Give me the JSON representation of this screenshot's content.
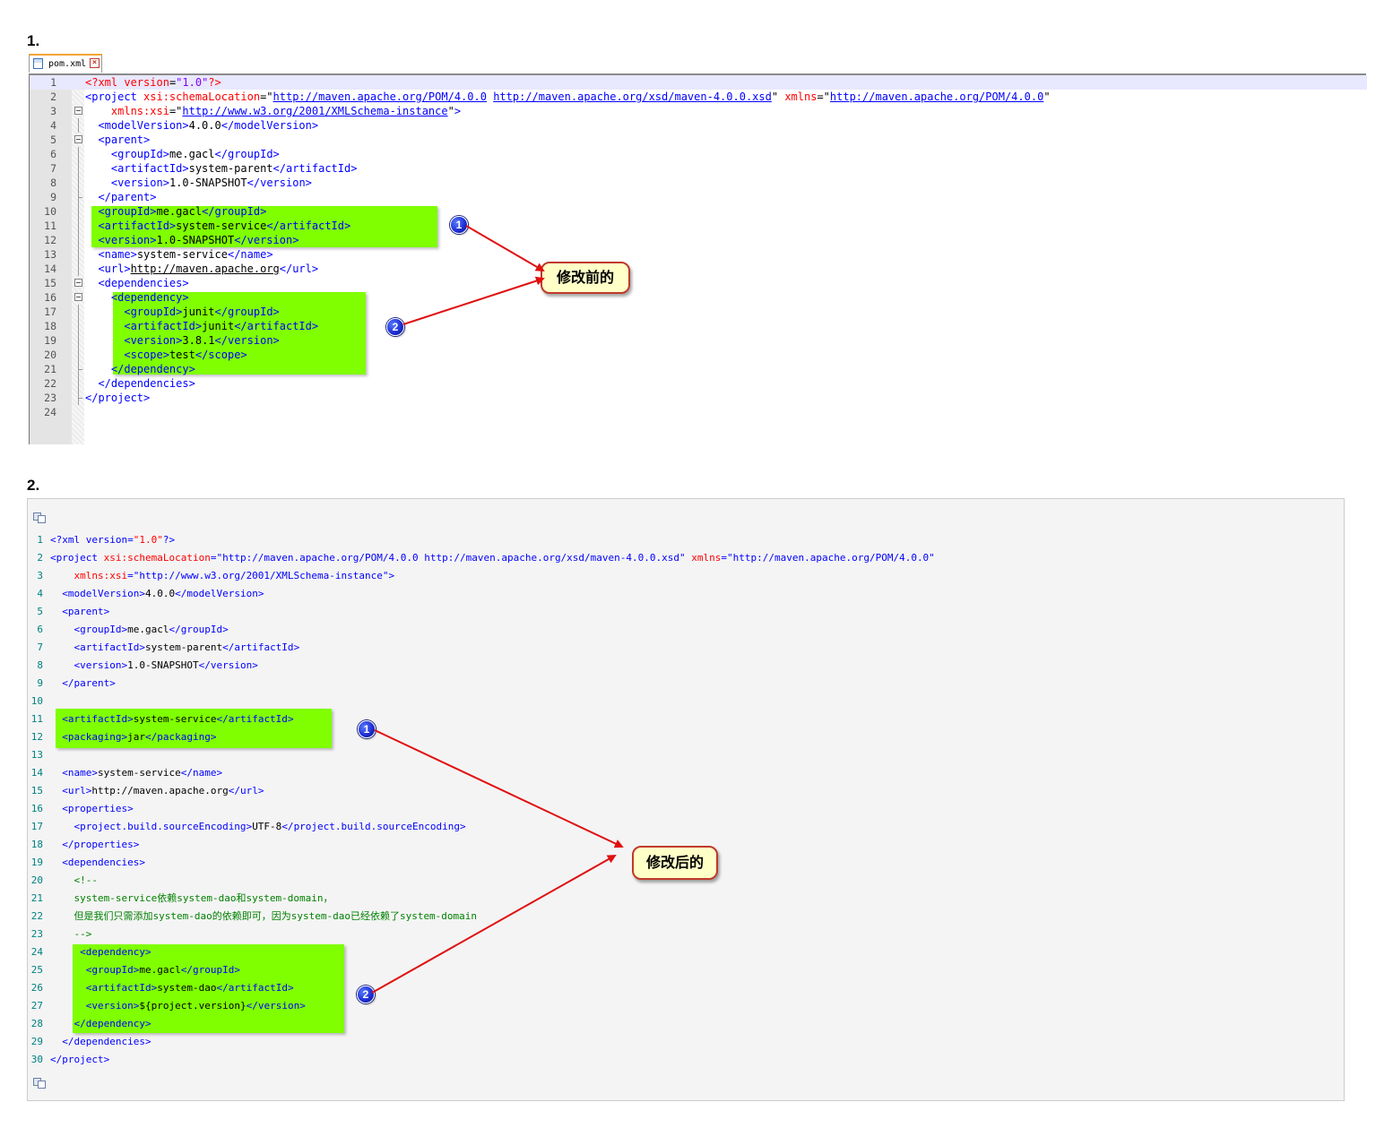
{
  "section1": {
    "heading": "1.",
    "tab_label": "pom.xml",
    "callout_label": "修改前的",
    "lines": [
      {
        "n": "1",
        "indent": "",
        "parts": [
          [
            "pi",
            "<?"
          ],
          [
            "pi",
            "xml "
          ],
          [
            "attr",
            "version"
          ],
          [
            "dq",
            "="
          ],
          [
            "val",
            "\"1.0\""
          ],
          [
            "pi",
            "?>"
          ]
        ]
      },
      {
        "n": "2",
        "indent": "",
        "parts": [
          [
            "tag",
            "<project "
          ],
          [
            "attr",
            "xsi:schemaLocation"
          ],
          [
            "dq",
            "=\""
          ],
          [
            "url",
            "http://maven.apache.org/POM/4.0.0"
          ],
          [
            "dq",
            " "
          ],
          [
            "url",
            "http://maven.apache.org/xsd/maven-4.0.0.xsd"
          ],
          [
            "dq",
            "\" "
          ],
          [
            "attr",
            "xmlns"
          ],
          [
            "dq",
            "=\""
          ],
          [
            "url",
            "http://maven.apache.org/POM/4.0.0"
          ],
          [
            "dq",
            "\""
          ]
        ]
      },
      {
        "n": "3",
        "indent": "    ",
        "parts": [
          [
            "attr",
            "xmlns:xsi"
          ],
          [
            "dq",
            "=\""
          ],
          [
            "url",
            "http://www.w3.org/2001/XMLSchema-instance"
          ],
          [
            "dq",
            "\""
          ],
          [
            "tag",
            ">"
          ]
        ]
      },
      {
        "n": "4",
        "indent": "  ",
        "parts": [
          [
            "tag",
            "<modelVersion>"
          ],
          [
            "text",
            "4.0.0"
          ],
          [
            "tag",
            "</modelVersion>"
          ]
        ]
      },
      {
        "n": "5",
        "indent": "  ",
        "parts": [
          [
            "tag",
            "<parent>"
          ]
        ]
      },
      {
        "n": "6",
        "indent": "    ",
        "parts": [
          [
            "tag",
            "<groupId>"
          ],
          [
            "text",
            "me.gacl"
          ],
          [
            "tag",
            "</groupId>"
          ]
        ]
      },
      {
        "n": "7",
        "indent": "    ",
        "parts": [
          [
            "tag",
            "<artifactId>"
          ],
          [
            "text",
            "system-parent"
          ],
          [
            "tag",
            "</artifactId>"
          ]
        ]
      },
      {
        "n": "8",
        "indent": "    ",
        "parts": [
          [
            "tag",
            "<version>"
          ],
          [
            "text",
            "1.0-SNAPSHOT"
          ],
          [
            "tag",
            "</version>"
          ]
        ]
      },
      {
        "n": "9",
        "indent": "  ",
        "parts": [
          [
            "tag",
            "</parent>"
          ]
        ]
      },
      {
        "n": "10",
        "indent": "  ",
        "parts": [
          [
            "tag",
            "<groupId>"
          ],
          [
            "text",
            "me.gacl"
          ],
          [
            "tag",
            "</groupId>"
          ]
        ]
      },
      {
        "n": "11",
        "indent": "  ",
        "parts": [
          [
            "tag",
            "<artifactId>"
          ],
          [
            "text",
            "system-service"
          ],
          [
            "tag",
            "</artifactId>"
          ]
        ]
      },
      {
        "n": "12",
        "indent": "  ",
        "parts": [
          [
            "tag",
            "<version>"
          ],
          [
            "text",
            "1.0-SNAPSHOT"
          ],
          [
            "tag",
            "</version>"
          ]
        ]
      },
      {
        "n": "13",
        "indent": "  ",
        "parts": [
          [
            "tag",
            "<name>"
          ],
          [
            "text",
            "system-service"
          ],
          [
            "tag",
            "</name>"
          ]
        ]
      },
      {
        "n": "14",
        "indent": "  ",
        "parts": [
          [
            "tag",
            "<url>"
          ],
          [
            "textu",
            "http://maven.apache.org"
          ],
          [
            "tag",
            "</url>"
          ]
        ]
      },
      {
        "n": "15",
        "indent": "  ",
        "parts": [
          [
            "tag",
            "<dependencies>"
          ]
        ]
      },
      {
        "n": "16",
        "indent": "    ",
        "parts": [
          [
            "tag",
            "<dependency>"
          ]
        ]
      },
      {
        "n": "17",
        "indent": "      ",
        "parts": [
          [
            "tag",
            "<groupId>"
          ],
          [
            "text",
            "junit"
          ],
          [
            "tag",
            "</groupId>"
          ]
        ]
      },
      {
        "n": "18",
        "indent": "      ",
        "parts": [
          [
            "tag",
            "<artifactId>"
          ],
          [
            "text",
            "junit"
          ],
          [
            "tag",
            "</artifactId>"
          ]
        ]
      },
      {
        "n": "19",
        "indent": "      ",
        "parts": [
          [
            "tag",
            "<version>"
          ],
          [
            "text",
            "3.8.1"
          ],
          [
            "tag",
            "</version>"
          ]
        ]
      },
      {
        "n": "20",
        "indent": "      ",
        "parts": [
          [
            "tag",
            "<scope>"
          ],
          [
            "text",
            "test"
          ],
          [
            "tag",
            "</scope>"
          ]
        ]
      },
      {
        "n": "21",
        "indent": "    ",
        "parts": [
          [
            "tag",
            "</dependency>"
          ]
        ]
      },
      {
        "n": "22",
        "indent": "  ",
        "parts": [
          [
            "tag",
            "</dependencies>"
          ]
        ]
      },
      {
        "n": "23",
        "indent": "",
        "parts": [
          [
            "tag",
            "</project>"
          ]
        ]
      },
      {
        "n": "24",
        "indent": "",
        "parts": []
      }
    ]
  },
  "section2": {
    "heading": "2.",
    "callout_label": "修改后的",
    "lines": [
      {
        "n": "1",
        "indent": "",
        "parts": [
          [
            "br",
            "<?"
          ],
          [
            "tag",
            "xml version"
          ],
          [
            "br",
            "="
          ],
          [
            "attr",
            "\"1.0\""
          ],
          [
            "br",
            "?>"
          ]
        ]
      },
      {
        "n": "2",
        "indent": "",
        "parts": [
          [
            "br",
            "<"
          ],
          [
            "tag",
            "project "
          ],
          [
            "attr",
            "xsi:schemaLocation"
          ],
          [
            "br",
            "="
          ],
          [
            "val",
            "\"http://maven.apache.org/POM/4.0.0 http://maven.apache.org/xsd/maven-4.0.0.xsd\""
          ],
          [
            "text",
            " "
          ],
          [
            "attr",
            "xmlns"
          ],
          [
            "br",
            "="
          ],
          [
            "val",
            "\"http://maven.apache.org/POM/4.0.0\""
          ]
        ]
      },
      {
        "n": "3",
        "indent": "    ",
        "parts": [
          [
            "attr",
            "xmlns:xsi"
          ],
          [
            "br",
            "="
          ],
          [
            "val",
            "\"http://www.w3.org/2001/XMLSchema-instance\""
          ],
          [
            "br",
            ">"
          ]
        ]
      },
      {
        "n": "4",
        "indent": "  ",
        "parts": [
          [
            "br",
            "<"
          ],
          [
            "tag",
            "modelVersion"
          ],
          [
            "br",
            ">"
          ],
          [
            "text",
            "4.0.0"
          ],
          [
            "br",
            "</"
          ],
          [
            "tag",
            "modelVersion"
          ],
          [
            "br",
            ">"
          ]
        ]
      },
      {
        "n": "5",
        "indent": "  ",
        "parts": [
          [
            "br",
            "<"
          ],
          [
            "tag",
            "parent"
          ],
          [
            "br",
            ">"
          ]
        ]
      },
      {
        "n": "6",
        "indent": "    ",
        "parts": [
          [
            "br",
            "<"
          ],
          [
            "tag",
            "groupId"
          ],
          [
            "br",
            ">"
          ],
          [
            "text",
            "me.gacl"
          ],
          [
            "br",
            "</"
          ],
          [
            "tag",
            "groupId"
          ],
          [
            "br",
            ">"
          ]
        ]
      },
      {
        "n": "7",
        "indent": "    ",
        "parts": [
          [
            "br",
            "<"
          ],
          [
            "tag",
            "artifactId"
          ],
          [
            "br",
            ">"
          ],
          [
            "text",
            "system-parent"
          ],
          [
            "br",
            "</"
          ],
          [
            "tag",
            "artifactId"
          ],
          [
            "br",
            ">"
          ]
        ]
      },
      {
        "n": "8",
        "indent": "    ",
        "parts": [
          [
            "br",
            "<"
          ],
          [
            "tag",
            "version"
          ],
          [
            "br",
            ">"
          ],
          [
            "text",
            "1.0-SNAPSHOT"
          ],
          [
            "br",
            "</"
          ],
          [
            "tag",
            "version"
          ],
          [
            "br",
            ">"
          ]
        ]
      },
      {
        "n": "9",
        "indent": "  ",
        "parts": [
          [
            "br",
            "</"
          ],
          [
            "tag",
            "parent"
          ],
          [
            "br",
            ">"
          ]
        ]
      },
      {
        "n": "10",
        "indent": "",
        "parts": []
      },
      {
        "n": "11",
        "indent": "  ",
        "parts": [
          [
            "br",
            "<"
          ],
          [
            "tag",
            "artifactId"
          ],
          [
            "br",
            ">"
          ],
          [
            "text",
            "system-service"
          ],
          [
            "br",
            "</"
          ],
          [
            "tag",
            "artifactId"
          ],
          [
            "br",
            ">"
          ]
        ]
      },
      {
        "n": "12",
        "indent": "  ",
        "parts": [
          [
            "br",
            "<"
          ],
          [
            "tag",
            "packaging"
          ],
          [
            "br",
            ">"
          ],
          [
            "text",
            "jar"
          ],
          [
            "br",
            "</"
          ],
          [
            "tag",
            "packaging"
          ],
          [
            "br",
            ">"
          ]
        ]
      },
      {
        "n": "13",
        "indent": "",
        "parts": []
      },
      {
        "n": "14",
        "indent": "  ",
        "parts": [
          [
            "br",
            "<"
          ],
          [
            "tag",
            "name"
          ],
          [
            "br",
            ">"
          ],
          [
            "text",
            "system-service"
          ],
          [
            "br",
            "</"
          ],
          [
            "tag",
            "name"
          ],
          [
            "br",
            ">"
          ]
        ]
      },
      {
        "n": "15",
        "indent": "  ",
        "parts": [
          [
            "br",
            "<"
          ],
          [
            "tag",
            "url"
          ],
          [
            "br",
            ">"
          ],
          [
            "text",
            "http://maven.apache.org"
          ],
          [
            "br",
            "</"
          ],
          [
            "tag",
            "url"
          ],
          [
            "br",
            ">"
          ]
        ]
      },
      {
        "n": "16",
        "indent": "  ",
        "parts": [
          [
            "br",
            "<"
          ],
          [
            "tag",
            "properties"
          ],
          [
            "br",
            ">"
          ]
        ]
      },
      {
        "n": "17",
        "indent": "    ",
        "parts": [
          [
            "br",
            "<"
          ],
          [
            "tag",
            "project.build.sourceEncoding"
          ],
          [
            "br",
            ">"
          ],
          [
            "text",
            "UTF-8"
          ],
          [
            "br",
            "</"
          ],
          [
            "tag",
            "project.build.sourceEncoding"
          ],
          [
            "br",
            ">"
          ]
        ]
      },
      {
        "n": "18",
        "indent": "  ",
        "parts": [
          [
            "br",
            "</"
          ],
          [
            "tag",
            "properties"
          ],
          [
            "br",
            ">"
          ]
        ]
      },
      {
        "n": "19",
        "indent": "  ",
        "parts": [
          [
            "br",
            "<"
          ],
          [
            "tag",
            "dependencies"
          ],
          [
            "br",
            ">"
          ]
        ]
      },
      {
        "n": "20",
        "indent": "    ",
        "parts": [
          [
            "com",
            "<!--"
          ]
        ]
      },
      {
        "n": "21",
        "indent": "    ",
        "parts": [
          [
            "com",
            "system-service依赖system-dao和system-domain，"
          ]
        ]
      },
      {
        "n": "22",
        "indent": "    ",
        "parts": [
          [
            "com",
            "但是我们只需添加system-dao的依赖即可，因为system-dao已经依赖了system-domain"
          ]
        ]
      },
      {
        "n": "23",
        "indent": "    ",
        "parts": [
          [
            "com",
            "-->"
          ]
        ]
      },
      {
        "n": "24",
        "indent": "     ",
        "parts": [
          [
            "br",
            "<"
          ],
          [
            "tag",
            "dependency"
          ],
          [
            "br",
            ">"
          ]
        ]
      },
      {
        "n": "25",
        "indent": "      ",
        "parts": [
          [
            "br",
            "<"
          ],
          [
            "tag",
            "groupId"
          ],
          [
            "br",
            ">"
          ],
          [
            "text",
            "me.gacl"
          ],
          [
            "br",
            "</"
          ],
          [
            "tag",
            "groupId"
          ],
          [
            "br",
            ">"
          ]
        ]
      },
      {
        "n": "26",
        "indent": "      ",
        "parts": [
          [
            "br",
            "<"
          ],
          [
            "tag",
            "artifactId"
          ],
          [
            "br",
            ">"
          ],
          [
            "text",
            "system-dao"
          ],
          [
            "br",
            "</"
          ],
          [
            "tag",
            "artifactId"
          ],
          [
            "br",
            ">"
          ]
        ]
      },
      {
        "n": "27",
        "indent": "      ",
        "parts": [
          [
            "br",
            "<"
          ],
          [
            "tag",
            "version"
          ],
          [
            "br",
            ">"
          ],
          [
            "text",
            "${project.version}"
          ],
          [
            "br",
            "</"
          ],
          [
            "tag",
            "version"
          ],
          [
            "br",
            ">"
          ]
        ]
      },
      {
        "n": "28",
        "indent": "    ",
        "parts": [
          [
            "br",
            "</"
          ],
          [
            "tag",
            "dependency"
          ],
          [
            "br",
            ">"
          ]
        ]
      },
      {
        "n": "29",
        "indent": "  ",
        "parts": [
          [
            "br",
            "</"
          ],
          [
            "tag",
            "dependencies"
          ],
          [
            "br",
            ">"
          ]
        ]
      },
      {
        "n": "30",
        "indent": "",
        "parts": [
          [
            "br",
            "</"
          ],
          [
            "tag",
            "project"
          ],
          [
            "br",
            ">"
          ]
        ]
      }
    ]
  },
  "badges": [
    "1",
    "2"
  ],
  "colors": {
    "highlight": "#7fff00",
    "arrow": "#e01010",
    "callout_fill": "#ffffc8"
  }
}
